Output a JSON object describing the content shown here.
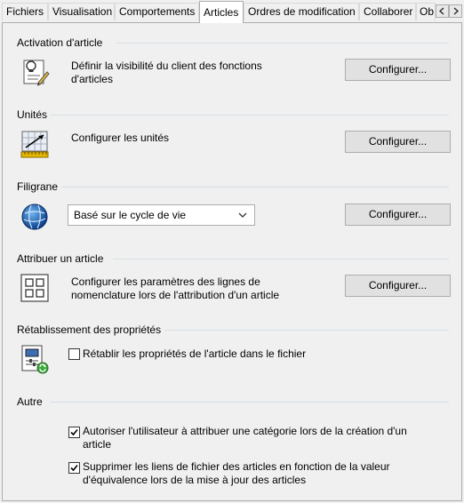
{
  "tabs": [
    {
      "label": "Fichiers"
    },
    {
      "label": "Visualisation"
    },
    {
      "label": "Comportements"
    },
    {
      "label": "Articles"
    },
    {
      "label": "Ordres de modification"
    },
    {
      "label": "Collaborer"
    },
    {
      "label": "Ob"
    }
  ],
  "active_tab": "Articles",
  "sections": {
    "activation": {
      "title": "Activation d'article",
      "desc_line1": "Définir la visibilité du client des fonctions",
      "desc_line2": "d'articles",
      "button": "Configurer..."
    },
    "unites": {
      "title": "Unités",
      "desc": "Configurer les unités",
      "button": "Configurer..."
    },
    "filigrane": {
      "title": "Filigrane",
      "select_value": "Basé sur le cycle de vie",
      "button": "Configurer..."
    },
    "attribuer": {
      "title": "Attribuer un article",
      "desc_line1": "Configurer les paramètres des lignes de",
      "desc_line2": "nomenclature lors de l'attribution d'un article",
      "button": "Configurer..."
    },
    "retablissement": {
      "title": "Rétablissement des propriétés",
      "checkbox_label": "Rétablir les propriétés de l'article dans le fichier",
      "checked": false
    },
    "autre": {
      "title": "Autre",
      "option1_line1": "Autoriser l'utilisateur à attribuer une catégorie lors de la création d'un",
      "option1_line2": "article",
      "option1_checked": true,
      "option2_line1": "Supprimer les liens de fichier des articles en fonction de la valeur",
      "option2_line2": "d'équivalence lors de la mise à jour des articles",
      "option2_checked": true
    }
  }
}
